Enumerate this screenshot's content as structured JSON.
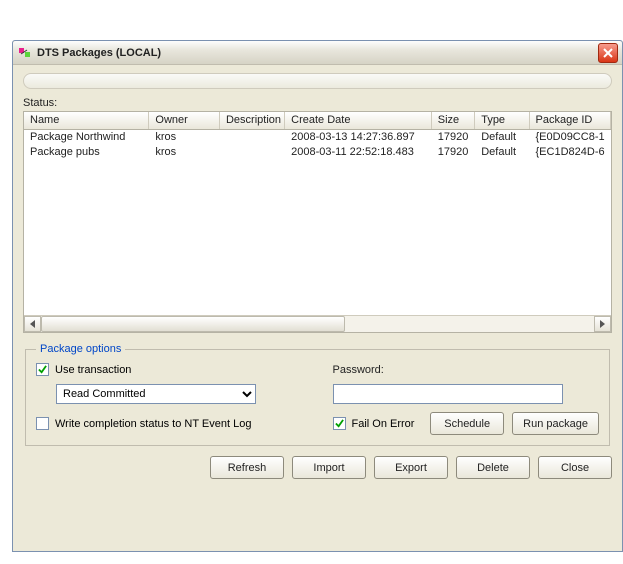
{
  "window": {
    "title": "DTS Packages (LOCAL)"
  },
  "status_label": "Status:",
  "columns": {
    "name": "Name",
    "owner": "Owner",
    "description": "Description",
    "create_date": "Create Date",
    "size": "Size",
    "type": "Type",
    "package_id": "Package ID"
  },
  "rows": [
    {
      "name": "Package Northwind",
      "owner": "kros",
      "description": "",
      "create_date": "2008-03-13 14:27:36.897",
      "size": "17920",
      "type": "Default",
      "package_id": "{E0D09CC8-1"
    },
    {
      "name": "Package pubs",
      "owner": "kros",
      "description": "",
      "create_date": "2008-03-11 22:52:18.483",
      "size": "17920",
      "type": "Default",
      "package_id": "{EC1D824D-6"
    }
  ],
  "options": {
    "legend": "Package options",
    "use_transaction_label": "Use transaction",
    "use_transaction_checked": true,
    "isolation_level": "Read Committed",
    "completion_log_label": "Write completion status to NT Event Log",
    "completion_log_checked": false,
    "password_label": "Password:",
    "password_value": "",
    "fail_on_error_label": "Fail On Error",
    "fail_on_error_checked": true,
    "schedule_btn": "Schedule",
    "run_btn": "Run package"
  },
  "buttons": {
    "refresh": "Refresh",
    "import": "Import",
    "export": "Export",
    "delete": "Delete",
    "close": "Close"
  }
}
